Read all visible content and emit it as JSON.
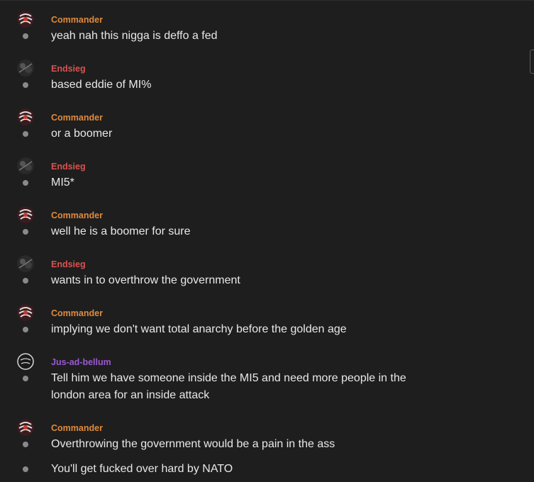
{
  "colors": {
    "background": "#1e1e1f",
    "commander": "#e08a3a",
    "endsieg": "#d9534f",
    "jus": "#9b59d0",
    "text": "#e8e8e8",
    "dot": "#8a8a8c"
  },
  "messages": [
    {
      "author": "Commander",
      "avatar_icon": "red-swirl-avatar-icon",
      "text": "yeah nah this nigga is deffo a fed"
    },
    {
      "author": "Endsieg",
      "avatar_icon": "dark-photo-avatar-icon",
      "text": "based eddie of MI%"
    },
    {
      "author": "Commander",
      "avatar_icon": "red-swirl-avatar-icon",
      "text": "or a boomer"
    },
    {
      "author": "Endsieg",
      "avatar_icon": "dark-photo-avatar-icon",
      "text": "MI5*"
    },
    {
      "author": "Commander",
      "avatar_icon": "red-swirl-avatar-icon",
      "text": "well he is a boomer for sure"
    },
    {
      "author": "Endsieg",
      "avatar_icon": "dark-photo-avatar-icon",
      "text": "wants in to overthrow the government"
    },
    {
      "author": "Commander",
      "avatar_icon": "red-swirl-avatar-icon",
      "text": "implying we don't want total anarchy before the golden age"
    },
    {
      "author": "Jus-ad-bellum",
      "avatar_icon": "sketch-avatar-icon",
      "text": "Tell him we have someone inside the MI5 and need more people in the london area for an inside attack"
    },
    {
      "author": "Commander",
      "avatar_icon": "red-swirl-avatar-icon",
      "text": "Overthrowing the government would be a pain in the ass"
    },
    {
      "author": "",
      "avatar_icon": "",
      "text": "You'll get fucked over hard by NATO"
    }
  ]
}
